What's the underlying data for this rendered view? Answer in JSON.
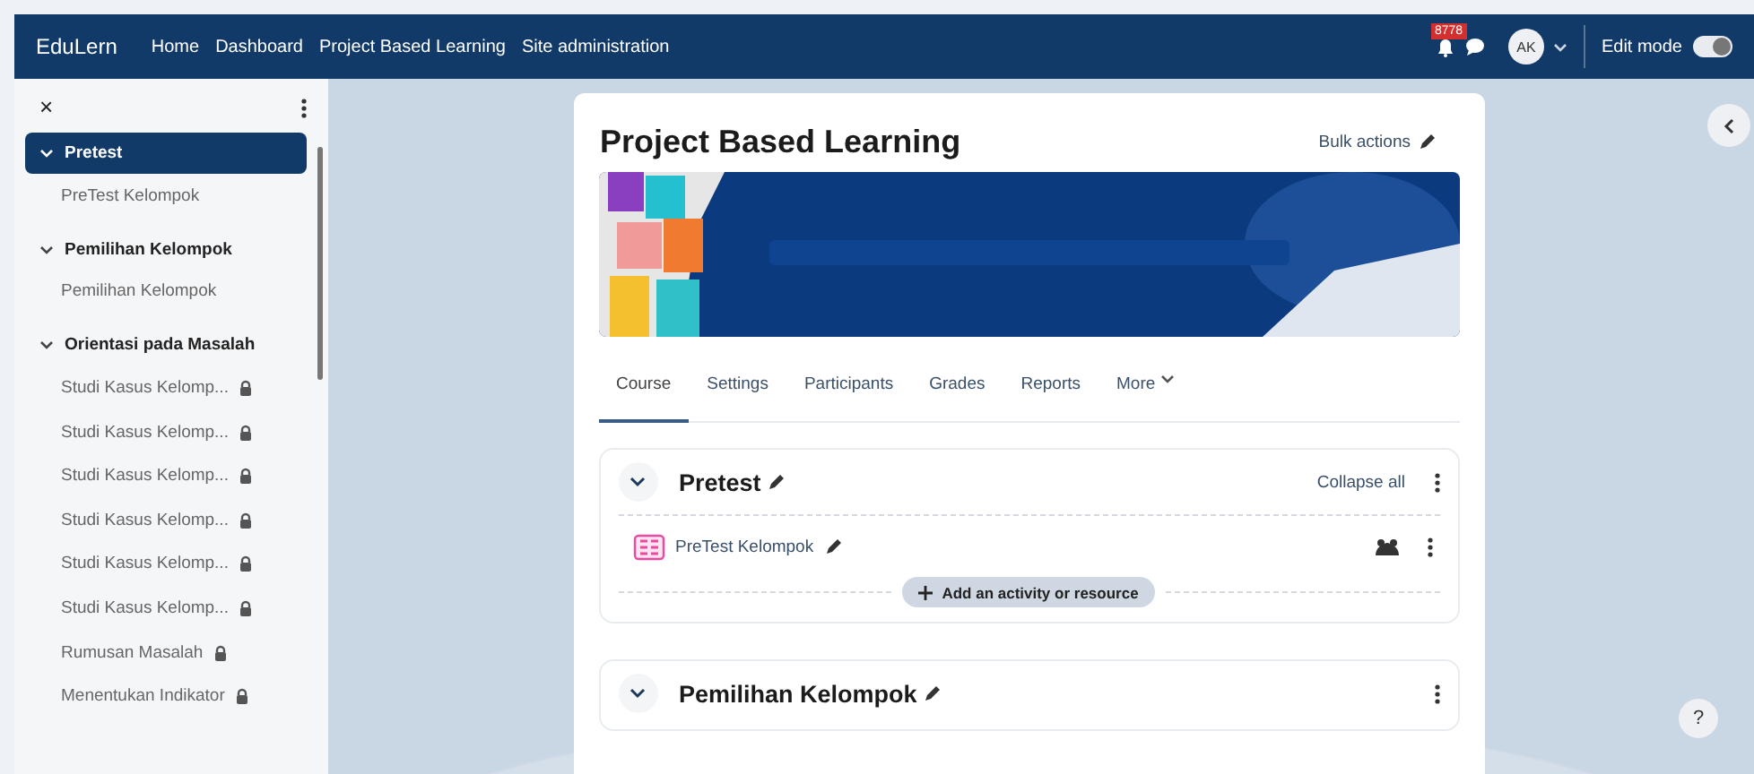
{
  "navbar": {
    "brand": "EduLern",
    "links": [
      "Home",
      "Dashboard",
      "Project Based Learning",
      "Site administration"
    ],
    "notification_count": "8778",
    "avatar": "AK",
    "edit_mode": {
      "label": "Edit mode",
      "on": true
    }
  },
  "sidebar": {
    "close": "×",
    "sections": [
      {
        "title": "Pretest",
        "expanded": true,
        "selected": true,
        "items": [
          {
            "label": "PreTest Kelompok",
            "locked": false
          }
        ]
      },
      {
        "title": "Pemilihan Kelompok",
        "expanded": true,
        "selected": false,
        "items": [
          {
            "label": "Pemilihan Kelompok",
            "locked": false
          }
        ]
      },
      {
        "title": "Orientasi pada Masalah",
        "expanded": true,
        "selected": false,
        "items": [
          {
            "label": "Studi Kasus Kelomp...",
            "locked": true
          },
          {
            "label": "Studi Kasus Kelomp...",
            "locked": true
          },
          {
            "label": "Studi Kasus Kelomp...",
            "locked": true
          },
          {
            "label": "Studi Kasus Kelomp...",
            "locked": true
          },
          {
            "label": "Studi Kasus Kelomp...",
            "locked": true
          },
          {
            "label": "Studi Kasus Kelomp...",
            "locked": true
          },
          {
            "label": "Rumusan Masalah",
            "locked": true
          },
          {
            "label": "Menentukan Indikator",
            "locked": true
          }
        ]
      }
    ]
  },
  "course": {
    "title": "Project Based Learning",
    "bulk_actions": "Bulk actions",
    "tabs": [
      {
        "label": "Course",
        "selected": true
      },
      {
        "label": "Settings",
        "selected": false
      },
      {
        "label": "Participants",
        "selected": false
      },
      {
        "label": "Grades",
        "selected": false
      },
      {
        "label": "Reports",
        "selected": false
      },
      {
        "label": "More",
        "selected": false
      }
    ],
    "sections": [
      {
        "title": "Pretest",
        "expanded": true,
        "collapse_all": "Collapse all",
        "activities": [
          {
            "name": "PreTest Kelompok"
          }
        ],
        "add_button": "Add an activity or resource"
      },
      {
        "title": "Pemilihan Kelompok",
        "expanded": true
      }
    ]
  },
  "help": "?"
}
